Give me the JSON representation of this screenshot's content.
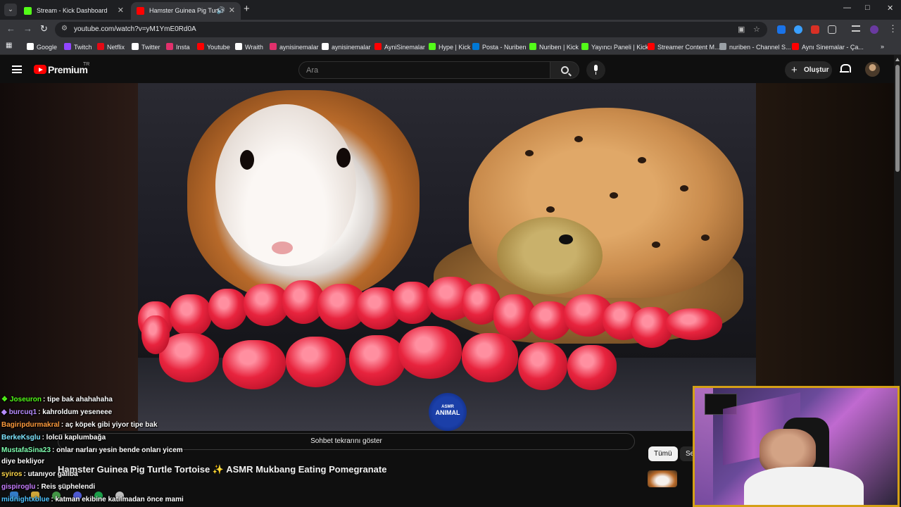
{
  "browser": {
    "tabs": [
      {
        "title": "Stream - Kick Dashboard",
        "favicon_color": "#53fc18"
      },
      {
        "title": "Hamster Guinea Pig Turtle",
        "favicon_color": "#ff0000"
      }
    ],
    "new_tab_glyph": "+",
    "window_controls": [
      "—",
      "□",
      "✕"
    ],
    "url": "youtube.com/watch?v=yM1YmE0Rd0A",
    "bookmarks": [
      {
        "label": "Google",
        "color": "#ffffff"
      },
      {
        "label": "Twitch",
        "color": "#9146ff"
      },
      {
        "label": "Netflix",
        "color": "#e50914"
      },
      {
        "label": "Twitter",
        "color": "#ffffff"
      },
      {
        "label": "Insta",
        "color": "#e1306c"
      },
      {
        "label": "Youtube",
        "color": "#ff0000"
      },
      {
        "label": "Wraith",
        "color": "#ffffff"
      },
      {
        "label": "aynisinemalar",
        "color": "#e1306c"
      },
      {
        "label": "aynisinemalar",
        "color": "#ffffff"
      },
      {
        "label": "AyniSinemalar",
        "color": "#ff0000"
      },
      {
        "label": "Hype | Kick",
        "color": "#53fc18"
      },
      {
        "label": "Posta - Nuriben",
        "color": "#0078d4"
      },
      {
        "label": "Nuriben | Kick",
        "color": "#53fc18"
      },
      {
        "label": "Yayıncı Paneli | Kick",
        "color": "#53fc18"
      },
      {
        "label": "Streamer Content M...",
        "color": "#ff0000"
      },
      {
        "label": "nuriben - Channel S...",
        "color": "#9aa0a6"
      },
      {
        "label": "Aynı Sinemalar - Ça...",
        "color": "#ff0000"
      }
    ]
  },
  "youtube": {
    "logo_text": "Premium",
    "country_code": "TR",
    "search_placeholder": "Ara",
    "create_label": "Oluştur",
    "chat_replay_label": "Sohbet tekrarını göster",
    "video_title_part1": "Hamster Guinea Pig Turtle Tortoise",
    "video_title_sparkle": "✨",
    "video_title_part2": "ASMR Mukbang Eating Pomegranate",
    "channel_badge_top": "ASMR",
    "channel_badge_bottom": "ANIMAL",
    "chips": [
      "Tümü",
      "Se"
    ]
  },
  "chat": [
    {
      "user": "Joseuron",
      "color": "#53fc18",
      "badge": "❖",
      "message": ": tipe bak ahahahaha"
    },
    {
      "user": "burcuq1",
      "color": "#b88cff",
      "badge": "◆",
      "message": ": kahroldum yeseneee"
    },
    {
      "user": "Bagiripdurmakral",
      "color": "#ff9a3c",
      "badge": "",
      "message": ": aç köpek gibi yiyor tipe bak"
    },
    {
      "user": "BerkeKsglu",
      "color": "#7fe6ff",
      "badge": "",
      "message": ": lolcü kaplumbağa"
    },
    {
      "user": "MustafaSina23",
      "color": "#7fffb0",
      "badge": "",
      "message": ": onlar narları yesin bende onları yicem"
    },
    {
      "user": "",
      "color": "#ffffff",
      "badge": "",
      "message": "diye bekliyor"
    },
    {
      "user": "syiros",
      "color": "#ffd84a",
      "badge": "",
      "message": ": utanıyor galiba"
    },
    {
      "user": "gispiroglu",
      "color": "#c77dff",
      "badge": "",
      "message": ": Reis şüphelendi"
    },
    {
      "user": "midnightxblue",
      "color": "#4fc3ff",
      "badge": "",
      "message": ": katman ekibine katılmadan önce mami"
    }
  ]
}
